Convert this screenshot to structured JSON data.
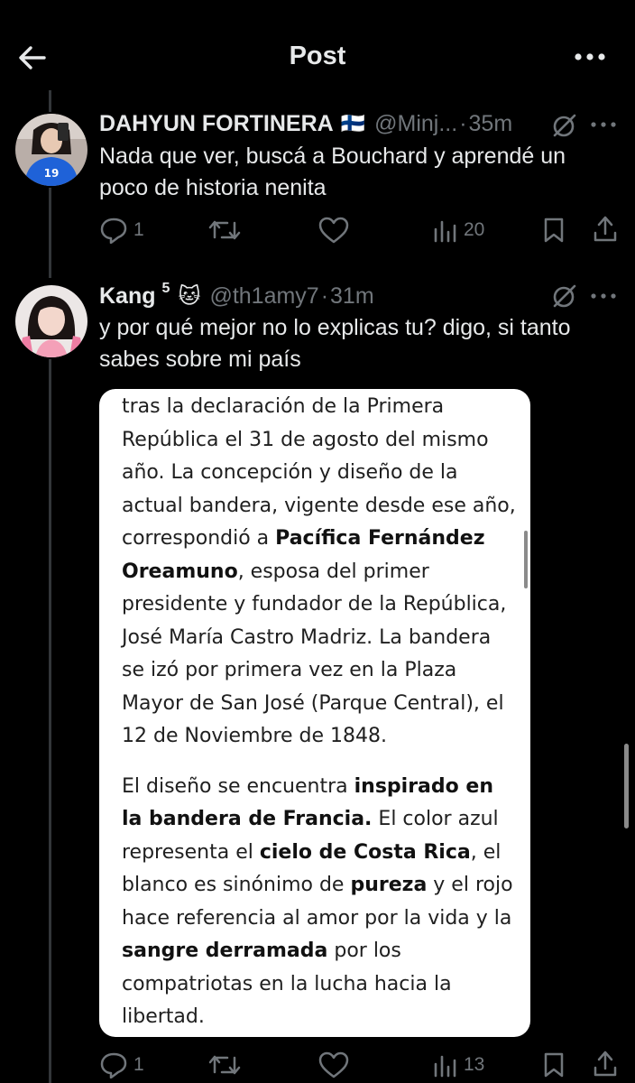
{
  "header": {
    "title": "Post",
    "back_icon": "arrow-left-icon",
    "more_icon": "more-horizontal-icon"
  },
  "reply1": {
    "display_name": "DAHYUN FORTINERA",
    "flag": "🇫🇮",
    "handle": "@Minj...",
    "separator": "·",
    "time": "35m",
    "text_lines": [
      "Nada que ver, buscá a Bouchard y aprendé un",
      "poco de historia nenita"
    ],
    "actions": {
      "replies": "1",
      "reposts": "",
      "likes": "",
      "views": "20"
    }
  },
  "reply2": {
    "display_name": "Kang",
    "superscript": "5",
    "emoji": "🐱",
    "handle": "@th1amy7",
    "separator": "·",
    "time": "31m",
    "text_lines": [
      "y por qué mejor no lo explicas tu? digo, si tanto",
      "sabes sobre mi país"
    ],
    "actions": {
      "replies": "1",
      "reposts": "",
      "likes": "",
      "views": "13"
    }
  },
  "quote": {
    "p1": [
      {
        "t": "tras la declaración de la Primera República el 31 de agosto del mismo año. La concepción y diseño de la actual bandera, vigente desde ese año, correspondió a ",
        "b": false
      },
      {
        "t": "Pacífica Fernández Oreamuno",
        "b": true
      },
      {
        "t": ", esposa del primer presidente y fundador de la República, José María Castro Madriz. La bandera se izó por primera vez en la Plaza Mayor de San José (Parque Central), el 12 de Noviembre de 1848.",
        "b": false
      }
    ],
    "p2": [
      {
        "t": "El diseño se encuentra ",
        "b": false
      },
      {
        "t": "inspirado en la bandera de Francia.",
        "b": true
      },
      {
        "t": " El color azul representa el ",
        "b": false
      },
      {
        "t": "cielo de Costa Rica",
        "b": true
      },
      {
        "t": ", el blanco es sinónimo de ",
        "b": false
      },
      {
        "t": "pureza",
        "b": true
      },
      {
        "t": " y el rojo hace referencia al amor por la vida y la ",
        "b": false
      },
      {
        "t": "sangre derramada",
        "b": true
      },
      {
        "t": " por los compatriotas en la lucha hacia la libertad.",
        "b": false
      }
    ]
  },
  "colors": {
    "background": "#000000",
    "text": "#e7e9ea",
    "muted": "#71767b",
    "thread_line": "#333639",
    "card": "#ffffff"
  }
}
